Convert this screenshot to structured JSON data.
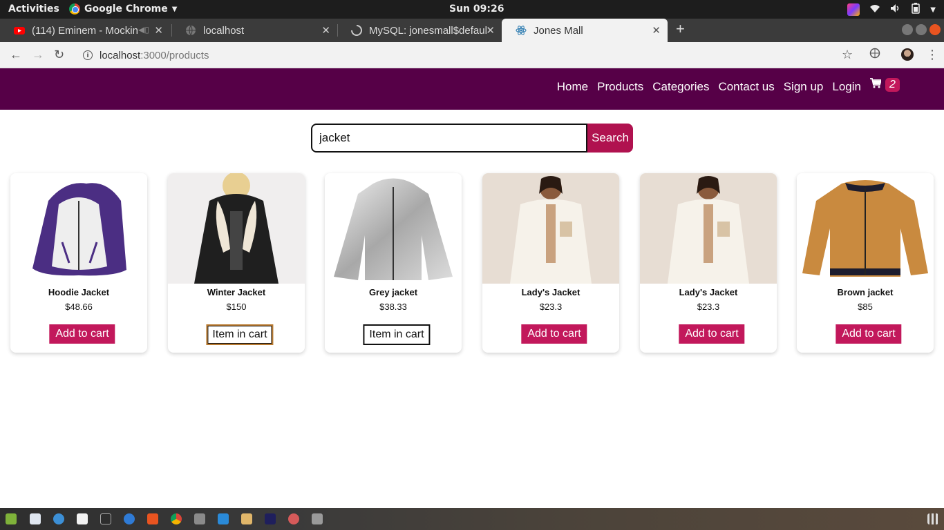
{
  "os": {
    "activities": "Activities",
    "app_name": "Google Chrome",
    "clock": "Sun 09:26"
  },
  "tabs": [
    {
      "title": "(114) Eminem - Mockin",
      "favicon": "youtube-icon"
    },
    {
      "title": "localhost",
      "favicon": "globe-icon"
    },
    {
      "title": "MySQL: jonesmall$defaul",
      "favicon": "loading-icon"
    },
    {
      "title": "Jones Mall",
      "favicon": "react-icon"
    }
  ],
  "address": {
    "host": "localhost",
    "path": ":3000/products"
  },
  "site": {
    "nav": [
      "Home",
      "Products",
      "Categories",
      "Contact us",
      "Sign up",
      "Login"
    ],
    "cart_count": "2"
  },
  "search": {
    "value": "jacket",
    "button": "Search"
  },
  "products": [
    {
      "name": "Hoodie Jacket",
      "price": "$48.66",
      "button": "Add to cart",
      "in_cart": false
    },
    {
      "name": "Winter Jacket",
      "price": "$150",
      "button": "Item in cart",
      "in_cart": true
    },
    {
      "name": "Grey jacket",
      "price": "$38.33",
      "button": "Item in cart",
      "in_cart": true
    },
    {
      "name": "Lady's Jacket",
      "price": "$23.3",
      "button": "Add to cart",
      "in_cart": false
    },
    {
      "name": "Lady's Jacket",
      "price": "$23.3",
      "button": "Add to cart",
      "in_cart": false
    },
    {
      "name": "Brown jacket",
      "price": "$85",
      "button": "Add to cart",
      "in_cart": false
    }
  ],
  "colors": {
    "header_bg": "#560047",
    "accent": "#c2185b",
    "search_button": "#b0124f"
  }
}
